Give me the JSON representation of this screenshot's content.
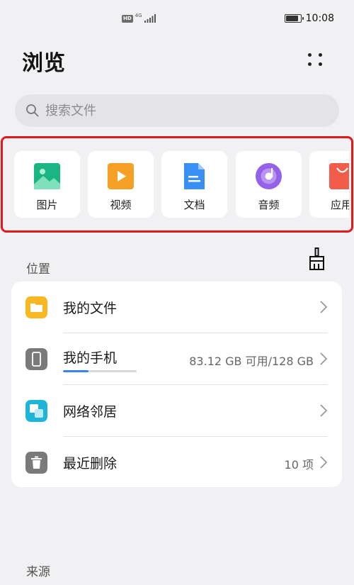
{
  "status_bar": {
    "hd_badge": "HD",
    "network": "4G",
    "time": "10:08",
    "battery_level_percent": 90
  },
  "header": {
    "title": "浏览",
    "more_icon": "more-vertical-dots-icon"
  },
  "search": {
    "placeholder": "搜索文件",
    "icon": "search-icon"
  },
  "categories": [
    {
      "label": "图片",
      "icon": "image-icon",
      "color": "#19b583"
    },
    {
      "label": "视频",
      "icon": "video-play-icon",
      "color": "#f4a125"
    },
    {
      "label": "文档",
      "icon": "document-icon",
      "color": "#3a8ff5"
    },
    {
      "label": "音频",
      "icon": "music-disc-icon",
      "color": "#9561e8"
    },
    {
      "label": "应用",
      "icon": "app-bag-icon",
      "color": "#f25d4b"
    }
  ],
  "location_section": {
    "title": "位置",
    "clean_icon": "clean-broom-icon",
    "rows": [
      {
        "title": "我的文件",
        "value": "",
        "icon": "folder-icon",
        "color": "#f7b822"
      },
      {
        "title": "我的手机",
        "value": "83.12 GB 可用/128 GB",
        "icon": "phone-icon",
        "color": "#7a7a7a",
        "storage_used_fraction": 0.35
      },
      {
        "title": "网络邻居",
        "value": "",
        "icon": "network-neighbor-icon",
        "color": "#1fb5d8"
      },
      {
        "title": "最近删除",
        "value": "10 项",
        "icon": "trash-icon",
        "color": "#7a7a7a"
      }
    ]
  },
  "source_section": {
    "title": "来源"
  }
}
